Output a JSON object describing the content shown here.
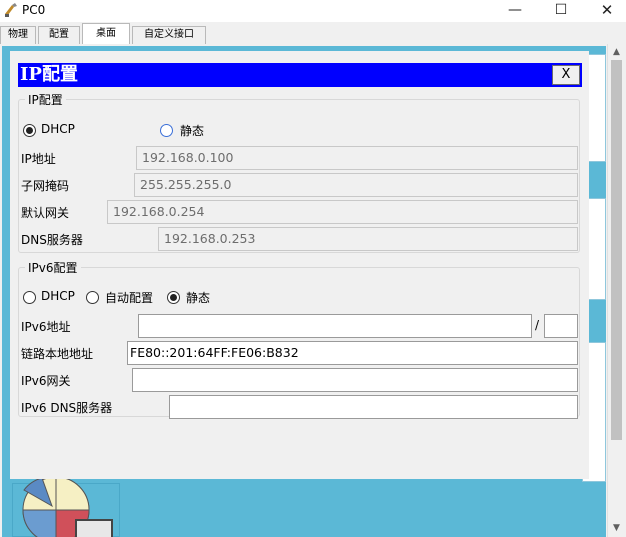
{
  "window": {
    "title": "PC0",
    "minimize": "—",
    "maximize": "☐",
    "close": "✕"
  },
  "tabs": [
    {
      "label": "物理"
    },
    {
      "label": "配置"
    },
    {
      "label": "桌面"
    },
    {
      "label": "自定义接口"
    }
  ],
  "active_tab": "桌面",
  "dialog": {
    "title": "IP配置",
    "close_label": "X",
    "ipv4": {
      "legend": "IP配置",
      "dhcp_label": "DHCP",
      "static_label": "静态",
      "selected_mode": "DHCP",
      "ip_label": "IP地址",
      "ip_value": "192.168.0.100",
      "mask_label": "子网掩码",
      "mask_value": "255.255.255.0",
      "gateway_label": "默认网关",
      "gateway_value": "192.168.0.254",
      "dns_label": "DNS服务器",
      "dns_value": "192.168.0.253"
    },
    "ipv6": {
      "legend": "IPv6配置",
      "dhcp_label": "DHCP",
      "auto_label": "自动配置",
      "static_label": "静态",
      "selected_mode": "静态",
      "addr_label": "IPv6地址",
      "addr_value": "",
      "prefix_sep": "/",
      "prefix_value": "",
      "link_local_label": "链路本地地址",
      "link_local_value": "FE80::201:64FF:FE06:B832",
      "gateway_label": "IPv6网关",
      "gateway_value": "",
      "dns_label": "IPv6 DNS服务器",
      "dns_value": ""
    }
  },
  "scrollbar": {
    "up": "▲",
    "down": "▼"
  },
  "colors": {
    "dialog_header": "#0000ff",
    "desktop_bg": "#5bb8d6",
    "radio_accent": "#3a6fd8"
  },
  "icons": [
    "packet-tracer-pc-icon",
    "pie-chart-icon"
  ]
}
